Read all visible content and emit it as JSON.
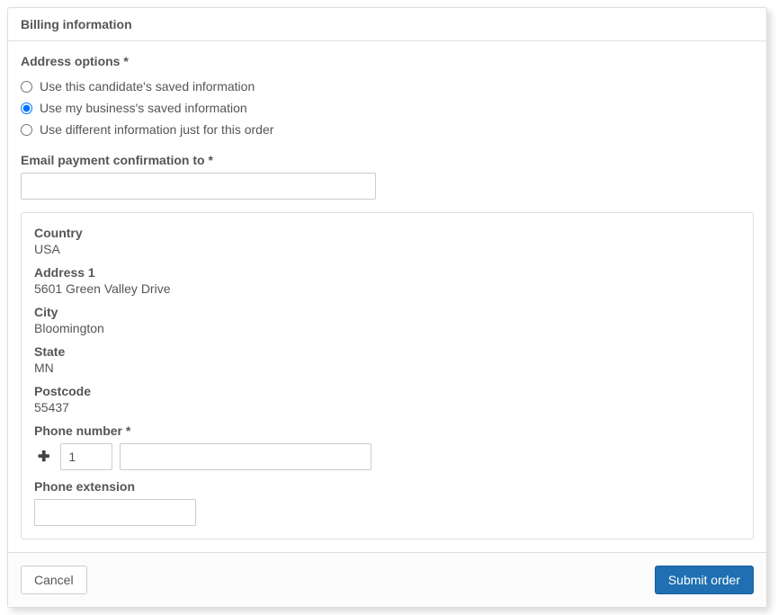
{
  "panel": {
    "title": "Billing information"
  },
  "addressOptions": {
    "label": "Address options *",
    "items": [
      {
        "label": "Use this candidate's saved information"
      },
      {
        "label": "Use my business's saved information"
      },
      {
        "label": "Use different information just for this order"
      }
    ],
    "selectedIndex": 1
  },
  "emailField": {
    "label": "Email payment confirmation to *",
    "value": ""
  },
  "address": {
    "countryLabel": "Country",
    "countryValue": "USA",
    "address1Label": "Address 1",
    "address1Value": "5601 Green Valley Drive",
    "cityLabel": "City",
    "cityValue": "Bloomington",
    "stateLabel": "State",
    "stateValue": "MN",
    "postcodeLabel": "Postcode",
    "postcodeValue": "55437"
  },
  "phone": {
    "label": "Phone number *",
    "countryCode": "1",
    "number": ""
  },
  "extension": {
    "label": "Phone extension",
    "value": ""
  },
  "footer": {
    "cancel": "Cancel",
    "submit": "Submit order"
  }
}
